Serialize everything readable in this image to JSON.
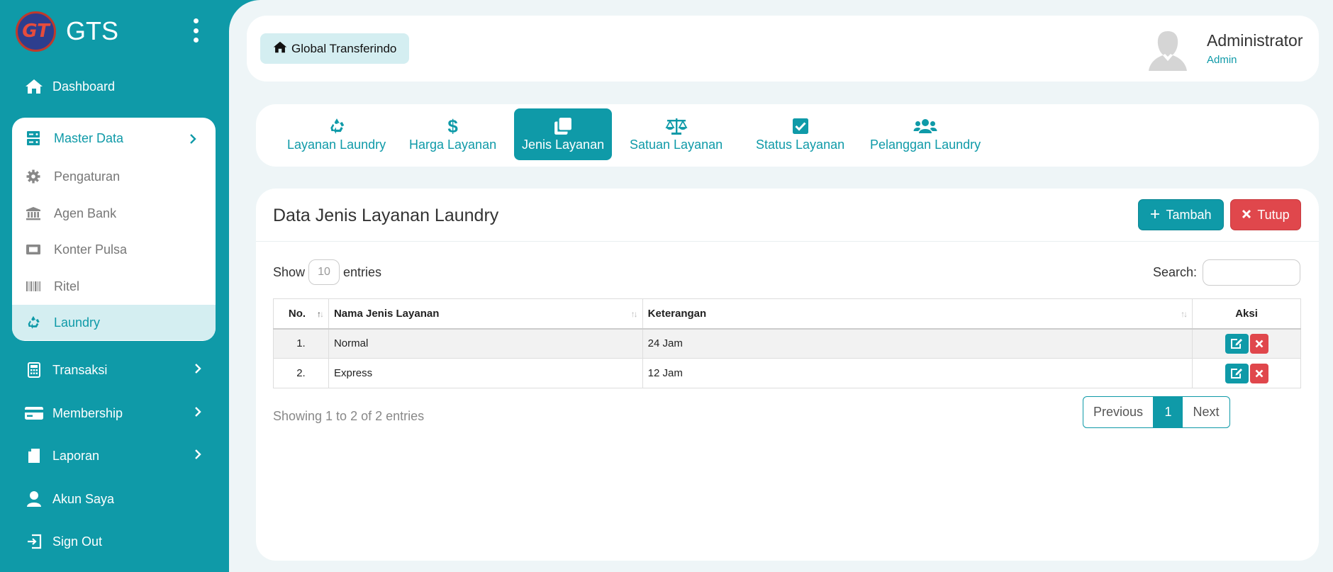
{
  "brand": {
    "logo_text": "GT",
    "name": "GTS"
  },
  "sidebar": {
    "dashboard": "Dashboard",
    "master_data": {
      "label": "Master Data",
      "items": [
        "Pengaturan",
        "Agen Bank",
        "Konter Pulsa",
        "Ritel",
        "Laundry"
      ],
      "active": "Laundry"
    },
    "transaksi": "Transaksi",
    "membership": "Membership",
    "laporan": "Laporan",
    "akun_saya": "Akun Saya",
    "sign_out": "Sign Out"
  },
  "topbar": {
    "home_label": "Global Transferindo",
    "user_name": "Administrator",
    "user_role": "Admin"
  },
  "tabs": [
    {
      "label": "Layanan Laundry",
      "icon": "recycle-icon"
    },
    {
      "label": "Harga Layanan",
      "icon": "dollar-icon"
    },
    {
      "label": "Jenis Layanan",
      "icon": "clone-icon",
      "active": true
    },
    {
      "label": "Satuan Layanan",
      "icon": "balance-scale-icon"
    },
    {
      "label": "Status Layanan",
      "icon": "check-square-icon"
    },
    {
      "label": "Pelanggan Laundry",
      "icon": "users-icon"
    }
  ],
  "card": {
    "title": "Data Jenis Layanan Laundry",
    "add_label": "Tambah",
    "close_label": "Tutup"
  },
  "table_controls": {
    "show_label": "Show",
    "entries_value": "10",
    "entries_label": "entries",
    "search_label": "Search:",
    "search_value": ""
  },
  "table": {
    "headers": [
      "No.",
      "Nama Jenis Layanan",
      "Keterangan",
      "Aksi"
    ],
    "rows": [
      {
        "no": "1.",
        "nama": "Normal",
        "keterangan": "24 Jam"
      },
      {
        "no": "2.",
        "nama": "Express",
        "keterangan": "12 Jam"
      }
    ]
  },
  "footer": {
    "info": "Showing 1 to 2 of 2 entries",
    "previous": "Previous",
    "current_page": "1",
    "next": "Next"
  },
  "colors": {
    "accent": "#0f9aa8",
    "danger": "#e0474c",
    "light_accent": "#d4eef1"
  }
}
